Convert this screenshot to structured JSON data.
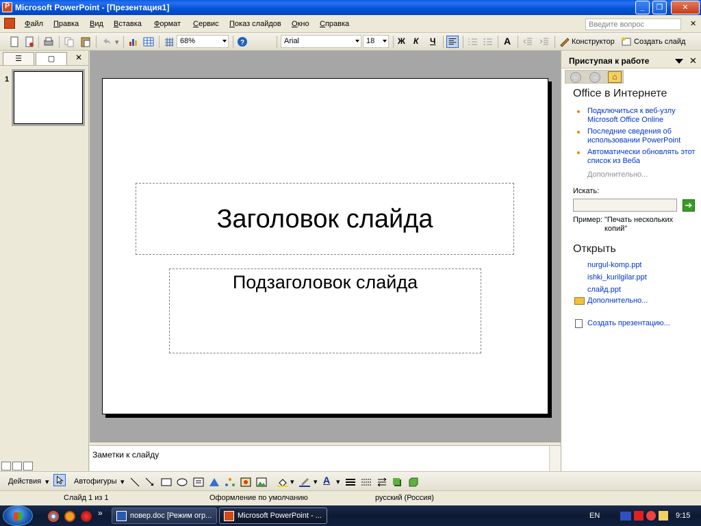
{
  "window": {
    "title": "Microsoft PowerPoint - [Презентация1]",
    "minimize": "_",
    "restore": "❐",
    "close": "✕"
  },
  "menu": {
    "items": [
      "Файл",
      "Правка",
      "Вид",
      "Вставка",
      "Формат",
      "Сервис",
      "Показ слайдов",
      "Окно",
      "Справка"
    ],
    "ask_placeholder": "Введите вопрос",
    "close": "✕"
  },
  "toolbar": {
    "zoom": "68%",
    "font": "Arial",
    "size": "18",
    "bold": "Ж",
    "italic": "К",
    "underline": "Ч",
    "designer": "Конструктор",
    "new_slide": "Создать слайд",
    "font_grow": "A"
  },
  "left_pane": {
    "tab_outline": "☰",
    "tab_slides": "▢",
    "close": "✕",
    "slide_number": "1"
  },
  "slide": {
    "title": "Заголовок слайда",
    "subtitle": "Подзаголовок слайда"
  },
  "notes": {
    "placeholder": "Заметки к слайду"
  },
  "task_pane": {
    "title": "Приступая к работе",
    "close": "✕",
    "home_glyph": "⌂",
    "section_online": "Office в Интернете",
    "links": [
      "Подключиться к веб-узлу Microsoft Office Online",
      "Последние сведения об использовании PowerPoint",
      "Автоматически обновлять этот список из Веба"
    ],
    "more_dim": "Дополнительно...",
    "search_label": "Искать:",
    "go_glyph": "➔",
    "example_label": "Пример:",
    "example_text": "\"Печать нескольких копий\"",
    "section_open": "Открыть",
    "files": [
      "nurgul-komp.ppt",
      "ishki_kurilgilar.ppt",
      "слайд.ppt"
    ],
    "open_more": "Дополнительно...",
    "create": "Создать презентацию..."
  },
  "drawing": {
    "actions": "Действия",
    "autoshapes": "Автофигуры",
    "font_color_glyph": "A"
  },
  "status": {
    "slide": "Слайд 1 из 1",
    "design": "Оформление по умолчанию",
    "language": "русский (Россия)"
  },
  "taskbar": {
    "buttons": [
      {
        "label": "повер.doc [Режим огр...",
        "active": false
      },
      {
        "label": "Microsoft PowerPoint - ...",
        "active": true
      }
    ],
    "language": "EN",
    "time": "9:15",
    "more": "»"
  },
  "colors": {
    "title_bar": "#0052d6",
    "link": "#0033cc",
    "bullet": "#f08000",
    "slide_background": "#a6a6a6"
  }
}
